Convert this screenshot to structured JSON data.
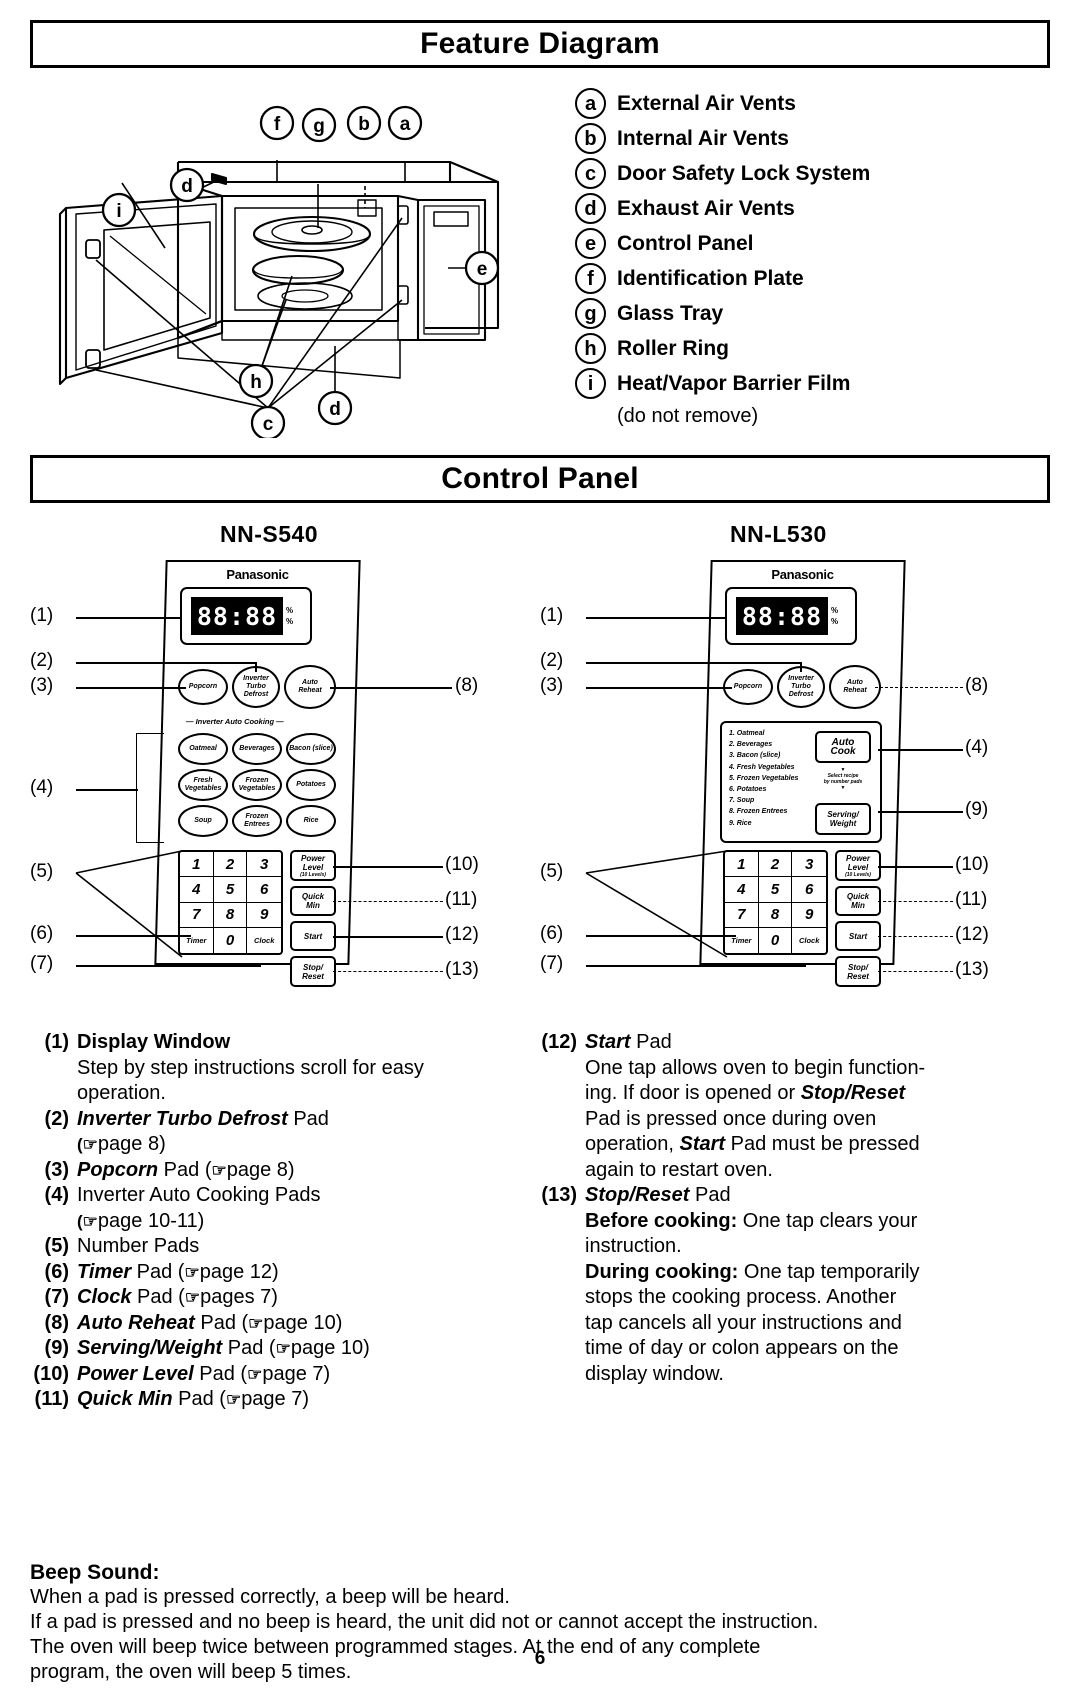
{
  "sections": {
    "feature_diagram_title": "Feature Diagram",
    "control_panel_title": "Control Panel"
  },
  "legend": {
    "items": [
      {
        "key": "a",
        "label": "External Air Vents"
      },
      {
        "key": "b",
        "label": "Internal Air Vents"
      },
      {
        "key": "c",
        "label": "Door Safety Lock System"
      },
      {
        "key": "d",
        "label": "Exhaust Air Vents"
      },
      {
        "key": "e",
        "label": "Control Panel"
      },
      {
        "key": "f",
        "label": "Identification Plate"
      },
      {
        "key": "g",
        "label": "Glass Tray"
      },
      {
        "key": "h",
        "label": "Roller Ring"
      },
      {
        "key": "i",
        "label": "Heat/Vapor Barrier Film"
      }
    ],
    "note": "(do not remove)"
  },
  "diagram_callouts": [
    "d",
    "i",
    "f",
    "g",
    "b",
    "a",
    "e",
    "h",
    "c",
    "d"
  ],
  "panels": [
    {
      "model": "NN-S540",
      "brand": "Panasonic",
      "display": "88:88",
      "display_units": [
        "%",
        "%"
      ],
      "top_pads": [
        {
          "line1": "Popcorn",
          "line2": "",
          "line3": ""
        },
        {
          "line1": "Inverter",
          "line2": "Turbo",
          "line3": "Defrost",
          "line4": ""
        },
        {
          "line1": "Auto",
          "line2": "Reheat",
          "line3": ""
        }
      ],
      "auto_cook_header": "— Inverter Auto Cooking —",
      "auto_pads": [
        "Oatmeal",
        "Beverages",
        "Bacon (slice)",
        "Fresh Vegetables",
        "Frozen Vegetables",
        "Potatoes",
        "Soup",
        "Frozen Entrees",
        "Rice"
      ],
      "number_keys": [
        "1",
        "2",
        "3",
        "4",
        "5",
        "6",
        "7",
        "8",
        "9",
        "Timer",
        "0",
        "Clock"
      ],
      "side_pads": [
        {
          "line1": "Power",
          "line2": "Level",
          "line3": "(10 Levels)"
        },
        {
          "line1": "Quick",
          "line2": "Min",
          "line3": ""
        },
        {
          "line1": "Start",
          "line2": "",
          "line3": ""
        },
        {
          "line1": "Stop/",
          "line2": "Reset",
          "line3": ""
        }
      ],
      "callouts_left": [
        "(1)",
        "(2)",
        "(3)",
        "(4)",
        "(5)",
        "(6)",
        "(7)"
      ],
      "callouts_right": [
        "(8)",
        "(10)",
        "(11)",
        "(12)",
        "(13)"
      ]
    },
    {
      "model": "NN-L530",
      "brand": "Panasonic",
      "display": "88:88",
      "display_units": [
        "%",
        "%"
      ],
      "top_pads": [
        {
          "line1": "Popcorn",
          "line2": "",
          "line3": ""
        },
        {
          "line1": "Inverter",
          "line2": "Turbo",
          "line3": "Defrost",
          "line4": ""
        },
        {
          "line1": "Auto",
          "line2": "Reheat",
          "line3": ""
        }
      ],
      "menu_items": [
        "1. Oatmeal",
        "2. Beverages",
        "3. Bacon (slice)",
        "4. Fresh Vegetables",
        "5. Frozen Vegetables",
        "6. Potatoes",
        "7. Soup",
        "8. Frozen Entrees",
        "9. Rice"
      ],
      "menu_pads": [
        {
          "line1": "Auto",
          "line2": "Cook"
        },
        {
          "line1": "Serving/",
          "line2": "Weight"
        }
      ],
      "menu_hint": "Select recipe\nby number pads",
      "number_keys": [
        "1",
        "2",
        "3",
        "4",
        "5",
        "6",
        "7",
        "8",
        "9",
        "Timer",
        "0",
        "Clock"
      ],
      "side_pads": [
        {
          "line1": "Power",
          "line2": "Level",
          "line3": "(10 Levels)"
        },
        {
          "line1": "Quick",
          "line2": "Min",
          "line3": ""
        },
        {
          "line1": "Start",
          "line2": "",
          "line3": ""
        },
        {
          "line1": "Stop/",
          "line2": "Reset",
          "line3": ""
        }
      ],
      "callouts_left": [
        "(1)",
        "(2)",
        "(3)",
        "(5)",
        "(6)",
        "(7)"
      ],
      "callouts_right": [
        "(8)",
        "(4)",
        "(9)",
        "(10)",
        "(11)",
        "(12)",
        "(13)"
      ]
    }
  ],
  "descriptions": {
    "left": [
      {
        "num": "(1)",
        "parts": [
          {
            "style": "b",
            "text": "Display Window"
          }
        ],
        "body": [
          {
            "parts": [
              {
                "style": "n",
                "text": "Step by step instructions scroll for easy"
              }
            ]
          },
          {
            "parts": [
              {
                "style": "n",
                "text": "operation."
              }
            ]
          }
        ]
      },
      {
        "num": "(2)",
        "parts": [
          {
            "style": "bi",
            "text": "Inverter Turbo Defrost"
          },
          {
            "style": "n",
            "text": " Pad"
          }
        ],
        "body": [
          {
            "parts": [
              {
                "style": "hand",
                "text": "(☞"
              },
              {
                "style": "n",
                "text": "page 8)"
              }
            ]
          }
        ]
      },
      {
        "num": "(3)",
        "parts": [
          {
            "style": "bi",
            "text": "Popcorn"
          },
          {
            "style": "n",
            "text": " Pad ("
          },
          {
            "style": "hand",
            "text": "☞"
          },
          {
            "style": "n",
            "text": "page 8)"
          }
        ],
        "body": []
      },
      {
        "num": "(4)",
        "parts": [
          {
            "style": "n",
            "text": "Inverter Auto Cooking Pads"
          }
        ],
        "body": [
          {
            "parts": [
              {
                "style": "hand",
                "text": "(☞"
              },
              {
                "style": "n",
                "text": "page 10-11)"
              }
            ]
          }
        ]
      },
      {
        "num": "(5)",
        "parts": [
          {
            "style": "n",
            "text": "Number Pads"
          }
        ],
        "body": []
      },
      {
        "num": "(6)",
        "parts": [
          {
            "style": "bi",
            "text": "Timer"
          },
          {
            "style": "n",
            "text": " Pad ("
          },
          {
            "style": "hand",
            "text": "☞"
          },
          {
            "style": "n",
            "text": "page 12)"
          }
        ],
        "body": []
      },
      {
        "num": "(7)",
        "parts": [
          {
            "style": "bi",
            "text": "Clock"
          },
          {
            "style": "n",
            "text": " Pad ("
          },
          {
            "style": "hand",
            "text": "☞"
          },
          {
            "style": "n",
            "text": "pages 7)"
          }
        ],
        "body": []
      },
      {
        "num": "(8)",
        "parts": [
          {
            "style": "bi",
            "text": "Auto Reheat"
          },
          {
            "style": "n",
            "text": " Pad ("
          },
          {
            "style": "hand",
            "text": "☞"
          },
          {
            "style": "n",
            "text": "page 10)"
          }
        ],
        "body": []
      },
      {
        "num": "(9)",
        "parts": [
          {
            "style": "bi",
            "text": "Serving/Weight"
          },
          {
            "style": "n",
            "text": " Pad ("
          },
          {
            "style": "hand",
            "text": "☞"
          },
          {
            "style": "n",
            "text": "page 10)"
          }
        ],
        "body": []
      },
      {
        "num": "(10)",
        "parts": [
          {
            "style": "bi",
            "text": "Power Level"
          },
          {
            "style": "n",
            "text": " Pad ("
          },
          {
            "style": "hand",
            "text": "☞"
          },
          {
            "style": "n",
            "text": "page 7)"
          }
        ],
        "body": []
      },
      {
        "num": "(11)",
        "parts": [
          {
            "style": "bi",
            "text": "Quick Min"
          },
          {
            "style": "n",
            "text": " Pad ("
          },
          {
            "style": "hand",
            "text": "☞"
          },
          {
            "style": "n",
            "text": "page 7)"
          }
        ],
        "body": []
      }
    ],
    "right": [
      {
        "num": "(12)",
        "parts": [
          {
            "style": "bi",
            "text": "Start"
          },
          {
            "style": "n",
            "text": " Pad"
          }
        ],
        "body": [
          {
            "parts": [
              {
                "style": "n",
                "text": "One tap allows oven to begin functio"
              },
              {
                "style": "n",
                "text": "n-"
              }
            ]
          },
          {
            "parts": [
              {
                "style": "n",
                "text": "ing. If door is opened or "
              },
              {
                "style": "bi",
                "text": "Stop/Reset"
              }
            ]
          },
          {
            "parts": [
              {
                "style": "n",
                "text": "Pad is pressed once during oven"
              }
            ]
          },
          {
            "parts": [
              {
                "style": "n",
                "text": "operation, "
              },
              {
                "style": "bi",
                "text": "Start"
              },
              {
                "style": "n",
                "text": " Pad must be pressed"
              }
            ]
          },
          {
            "parts": [
              {
                "style": "n",
                "text": "again to restart oven."
              }
            ]
          }
        ]
      },
      {
        "num": "(13)",
        "parts": [
          {
            "style": "bi",
            "text": "Stop/Reset"
          },
          {
            "style": "n",
            "text": " Pad"
          }
        ],
        "body": [
          {
            "parts": [
              {
                "style": "b",
                "text": "Before cooking: "
              },
              {
                "style": "n",
                "text": "One tap clears your"
              }
            ]
          },
          {
            "parts": [
              {
                "style": "n",
                "text": "instruction."
              }
            ]
          },
          {
            "parts": [
              {
                "style": "b",
                "text": "During cooking: "
              },
              {
                "style": "n",
                "text": "One tap temporarily"
              }
            ]
          },
          {
            "parts": [
              {
                "style": "n",
                "text": "stops the cooking process.  Another"
              }
            ]
          },
          {
            "parts": [
              {
                "style": "n",
                "text": "tap cancels all your instructions and"
              }
            ]
          },
          {
            "parts": [
              {
                "style": "n",
                "text": "time of day or colon appears on the"
              }
            ]
          },
          {
            "parts": [
              {
                "style": "n",
                "text": "display window."
              }
            ]
          }
        ]
      }
    ]
  },
  "beep": {
    "heading": "Beep Sound:",
    "lines": [
      "When a pad is pressed correctly, a beep will be heard.",
      "If a pad is pressed and no beep is heard, the unit did not or cannot accept the instruction.",
      "The oven will beep twice between programmed stages. At the end of any complete",
      "program, the oven will beep 5 times."
    ]
  },
  "page_number": "6"
}
